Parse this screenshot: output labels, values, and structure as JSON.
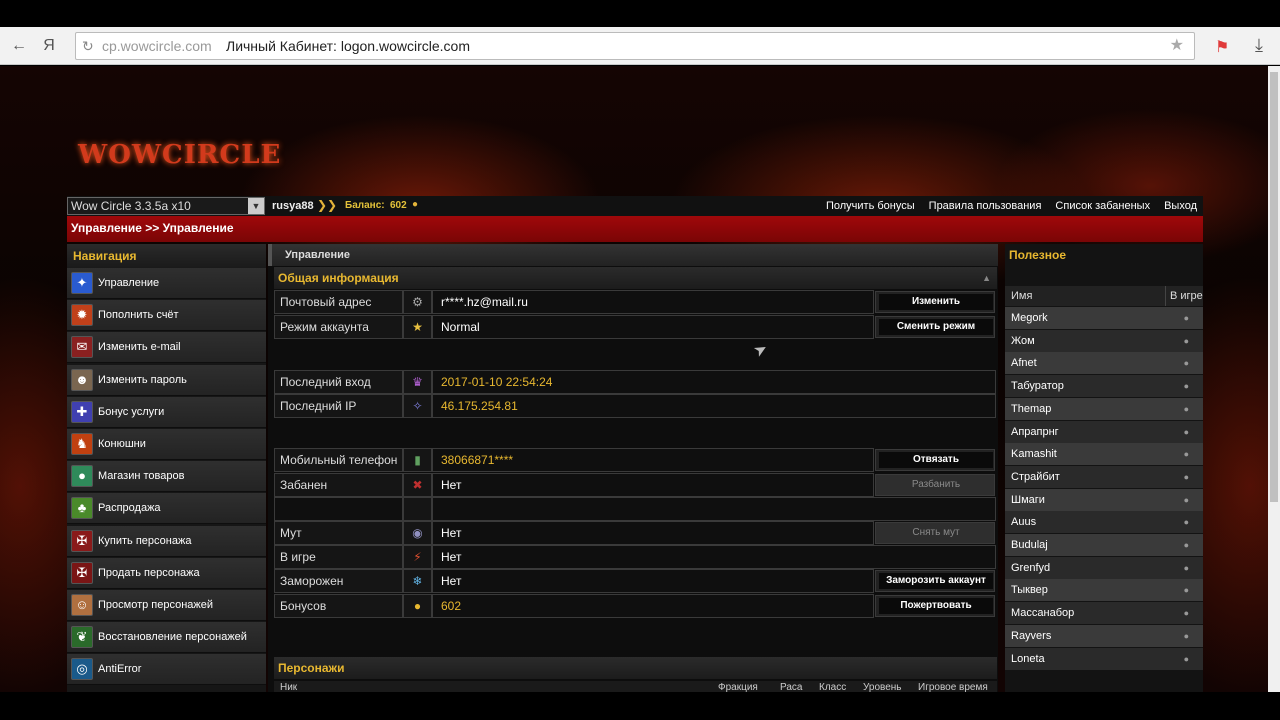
{
  "browser": {
    "domain": "cp.wowcircle.com",
    "page_title": "Личный Кабинет: logon.wowcircle.com",
    "back_icon": "←",
    "yandex_icon": "Я",
    "reload_icon": "↻",
    "bookmark_star_icon": "★",
    "bookmark_icon": "⚑",
    "download_icon": "⤓"
  },
  "site": {
    "logo_text": "WOWCIRCLE"
  },
  "userbar": {
    "realm": "Wow Circle 3.3.5a x10",
    "username": "rusya88",
    "balance_label": "Баланс:",
    "balance_value": "602",
    "links": [
      "Получить бонусы",
      "Правила пользования",
      "Список забаненых",
      "Выход"
    ]
  },
  "breadcrumb": "Управление >> Управление",
  "nav": {
    "title": "Навигация",
    "items": [
      {
        "label": "Управление",
        "icon": "✦",
        "color": "#2a5bd0"
      },
      {
        "label": "Пополнить счёт",
        "icon": "✹",
        "color": "#c0401a"
      },
      {
        "label": "Изменить e-mail",
        "icon": "✉",
        "color": "#8a2020"
      },
      {
        "label": "Изменить пароль",
        "icon": "☻",
        "color": "#7a6650"
      },
      {
        "label": "Бонус услуги",
        "icon": "✚",
        "color": "#4040b0"
      },
      {
        "label": "Конюшни",
        "icon": "♞",
        "color": "#c04010"
      },
      {
        "label": "Магазин товаров",
        "icon": "●",
        "color": "#2f8a5a"
      },
      {
        "label": "Распродажа",
        "icon": "♣",
        "color": "#4a8a2a"
      },
      {
        "label": "Купить персонажа",
        "icon": "✠",
        "color": "#8a1a1a"
      },
      {
        "label": "Продать персонажа",
        "icon": "✠",
        "color": "#7a1515"
      },
      {
        "label": "Просмотр персонажей",
        "icon": "☺",
        "color": "#b07040"
      },
      {
        "label": "Восстановление персонажей",
        "icon": "❦",
        "color": "#2a6a2a"
      },
      {
        "label": "AntiError",
        "icon": "◎",
        "color": "#1a5a8a"
      }
    ]
  },
  "center": {
    "title": "Управление",
    "general_info_title": "Общая информация",
    "rows": {
      "email": {
        "label": "Почтовый адрес",
        "value": "r****.hz@mail.ru",
        "button": "Изменить",
        "icon": "⚙",
        "icon_color": "#aaa"
      },
      "mode": {
        "label": "Режим аккаунта",
        "value": "Normal",
        "button": "Сменить режим",
        "icon": "★",
        "icon_color": "#e8c040"
      },
      "last_login": {
        "label": "Последний вход",
        "value": "2017-01-10 22:54:24",
        "icon": "♛",
        "icon_color": "#b060d0"
      },
      "last_ip": {
        "label": "Последний IP",
        "value": "46.175.254.81",
        "icon": "✧",
        "icon_color": "#8080e0"
      },
      "phone": {
        "label": "Мобильный телефон",
        "value": "38066871****",
        "button": "Отвязать",
        "icon": "▮",
        "icon_color": "#60a060"
      },
      "banned": {
        "label": "Забанен",
        "value": "Нет",
        "button": "Разбанить",
        "icon": "✖",
        "icon_color": "#c03030"
      },
      "mute": {
        "label": "Мут",
        "value": "Нет",
        "button": "Снять мут",
        "icon": "◉",
        "icon_color": "#9090c0"
      },
      "in_game": {
        "label": "В игре",
        "value": "Нет",
        "icon": "⚡",
        "icon_color": "#e05030"
      },
      "frozen": {
        "label": "Заморожен",
        "value": "Нет",
        "button": "Заморозить аккаунт",
        "icon": "❄",
        "icon_color": "#60b0e0"
      },
      "bonus": {
        "label": "Бонусов",
        "value": "602",
        "button": "Пожертвовать",
        "icon": "●",
        "icon_color": "#e8b830"
      }
    },
    "characters_title": "Персонажи",
    "char_columns": [
      "Ник",
      "Фракция",
      "Раса",
      "Класс",
      "Уровень",
      "Игровое время"
    ]
  },
  "right": {
    "title": "Полезное",
    "col_name": "Имя",
    "col_ingame": "В игре",
    "players": [
      "Megork",
      "Жом",
      "Afnet",
      "Табуратор",
      "Themap",
      "Апрапрнг",
      "Kamashit",
      "Страйбит",
      "Шмаги",
      "Auus",
      "Budulaj",
      "Grenfyd",
      "Тыквер",
      "Массанабор",
      "Rayvers",
      "Loneta"
    ]
  }
}
